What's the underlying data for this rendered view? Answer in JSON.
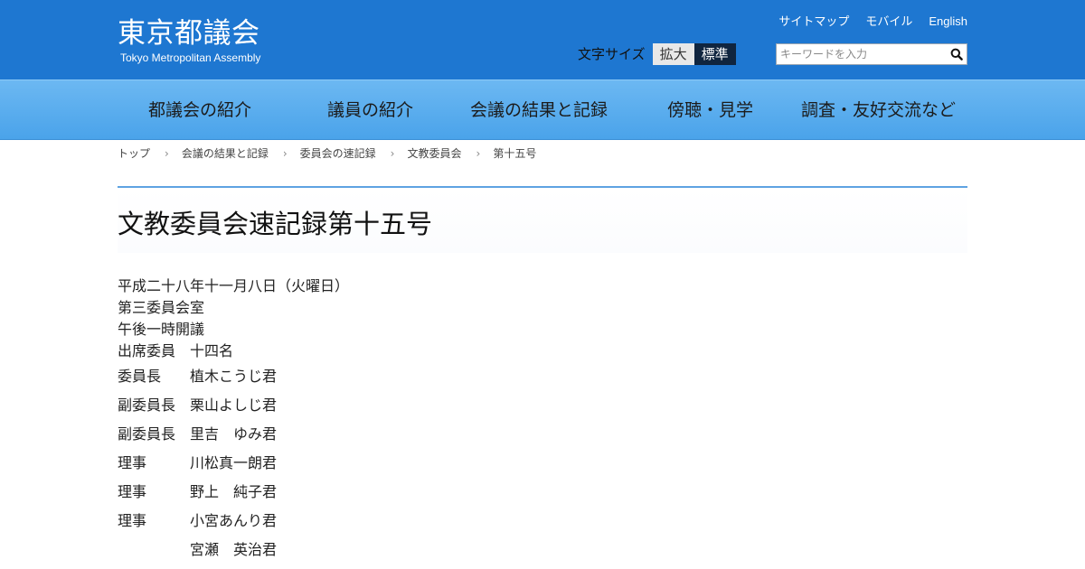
{
  "header": {
    "logo_main": "東京都議会",
    "logo_sub": "Tokyo Metropolitan Assembly",
    "util_links": [
      "サイトマップ",
      "モバイル",
      "English"
    ],
    "font_size_label": "文字サイズ",
    "font_size_large": "拡大",
    "font_size_normal": "標準",
    "search_placeholder": "キーワードを入力"
  },
  "nav": {
    "items": [
      "都議会の紹介",
      "議員の紹介",
      "会議の結果と記録",
      "傍聴・見学",
      "調査・友好交流など"
    ]
  },
  "breadcrumb": [
    "トップ",
    "会議の結果と記録",
    "委員会の速記録",
    "文教委員会",
    "第十五号"
  ],
  "page_title": "文教委員会速記録第十五号",
  "meeting": {
    "date": "平成二十八年十一月八日（火曜日）",
    "room": "第三委員会室",
    "opening": "午後一時開議",
    "attendance_label": "出席委員",
    "attendance_count": "十四名"
  },
  "members": [
    {
      "role": "委員長",
      "name": "植木こうじ君"
    },
    {
      "role": "副委員長",
      "name": "栗山よしじ君"
    },
    {
      "role": "副委員長",
      "name": "里吉　ゆみ君"
    },
    {
      "role": "理事",
      "name": "川松真一朗君"
    },
    {
      "role": "理事",
      "name": "野上　純子君"
    },
    {
      "role": "理事",
      "name": "小宮あんり君"
    },
    {
      "role": "",
      "name": "宮瀬　英治君"
    }
  ]
}
